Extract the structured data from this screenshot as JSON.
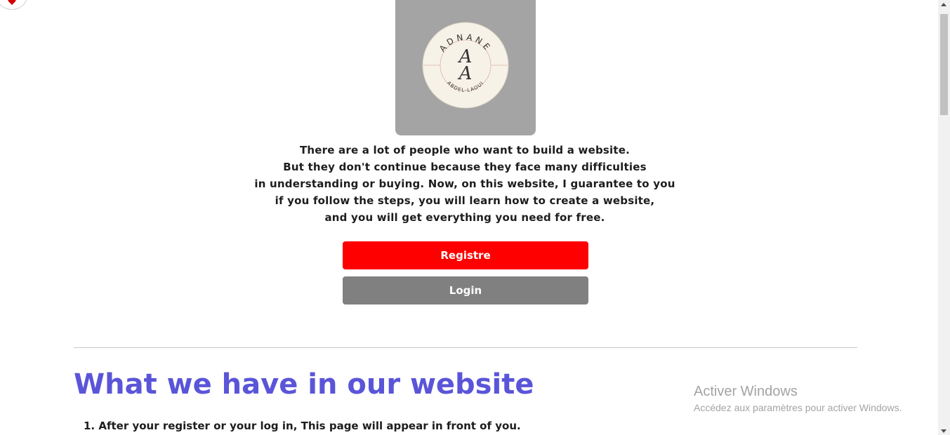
{
  "logo": {
    "brand_top": "ADNANE",
    "monogram": "AA",
    "brand_bottom": "ABDEL-LAOUI",
    "box_color": "#a4a4a4",
    "badge_color": "#f7f2e7"
  },
  "intro": {
    "lines": [
      "There are a lot of people who want to build a website.",
      "But they don't continue because they face many difficulties",
      "in understanding or buying. Now, on this website, I guarantee to you",
      "if you follow the steps, you will learn how to create a website,",
      "and you will get everything you need for free."
    ]
  },
  "buttons": {
    "register_label": "Registre",
    "register_color": "#ff0000",
    "login_label": "Login",
    "login_color": "#808080"
  },
  "section": {
    "title": "What we have in our website",
    "title_color": "#5a55d8",
    "items": [
      "1. After your register or your log in, This page will appear in front of you."
    ]
  },
  "watermark": {
    "title": "Activer Windows",
    "subtitle": "Accédez aux paramètres pour activer Windows."
  },
  "icons": {
    "corner": "heart-icon",
    "scroll_up": "chevron-up-icon",
    "scroll_down": "chevron-down-icon"
  }
}
